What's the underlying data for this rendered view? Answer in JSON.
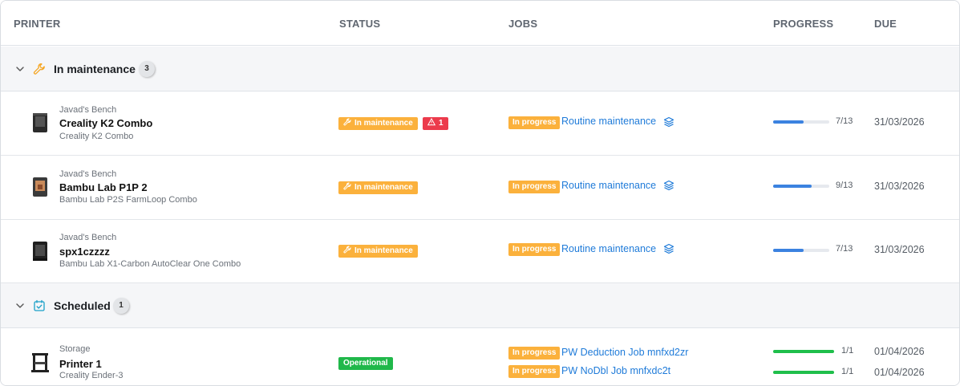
{
  "headers": {
    "printer": "PRINTER",
    "status": "STATUS",
    "jobs": "JOBS",
    "progress": "PROGRESS",
    "due": "DUE"
  },
  "groups": [
    {
      "title": "In maintenance",
      "count": "3",
      "icon": "wrench-icon",
      "icon_color": "#f5a623",
      "rows": [
        {
          "location": "Javad's Bench",
          "name": "Creality K2 Combo",
          "model": "Creality K2 Combo",
          "status": "In maintenance",
          "alert": "1",
          "job_state": "In progress",
          "job": "Routine maintenance",
          "progress_text": "7/13",
          "progress": 0.54,
          "due": "31/03/2026"
        },
        {
          "location": "Javad's Bench",
          "name": "Bambu Lab P1P 2",
          "model": "Bambu Lab P2S FarmLoop Combo",
          "status": "In maintenance",
          "job_state": "In progress",
          "job": "Routine maintenance",
          "progress_text": "9/13",
          "progress": 0.69,
          "due": "31/03/2026"
        },
        {
          "location": "Javad's Bench",
          "name": "spx1czzzz",
          "model": "Bambu Lab X1-Carbon AutoClear One Combo",
          "status": "In maintenance",
          "job_state": "In progress",
          "job": "Routine maintenance",
          "progress_text": "7/13",
          "progress": 0.54,
          "due": "31/03/2026"
        }
      ]
    },
    {
      "title": "Scheduled",
      "count": "1",
      "icon": "calendar-check-icon",
      "icon_color": "#1aa0c8",
      "rows": [
        {
          "location": "Storage",
          "name": "Printer 1",
          "model": "Creality Ender-3",
          "status": "Operational",
          "jobs": [
            {
              "job_state": "In progress",
              "job": "PW Deduction Job mnfxd2zr",
              "progress_text": "1/1",
              "progress": 1.0,
              "due": "01/04/2026"
            },
            {
              "job_state": "In progress",
              "job": "PW NoDbl Job mnfxdc2t",
              "progress_text": "1/1",
              "progress": 1.0,
              "due": "01/04/2026"
            }
          ]
        }
      ]
    }
  ],
  "colors": {
    "maintenance": "#fbb13c",
    "alert": "#ec3b4c",
    "operational": "#20b84a",
    "link": "#1f7bd9",
    "progress_blue": "#3b82e0",
    "progress_green": "#1fbf4b"
  }
}
